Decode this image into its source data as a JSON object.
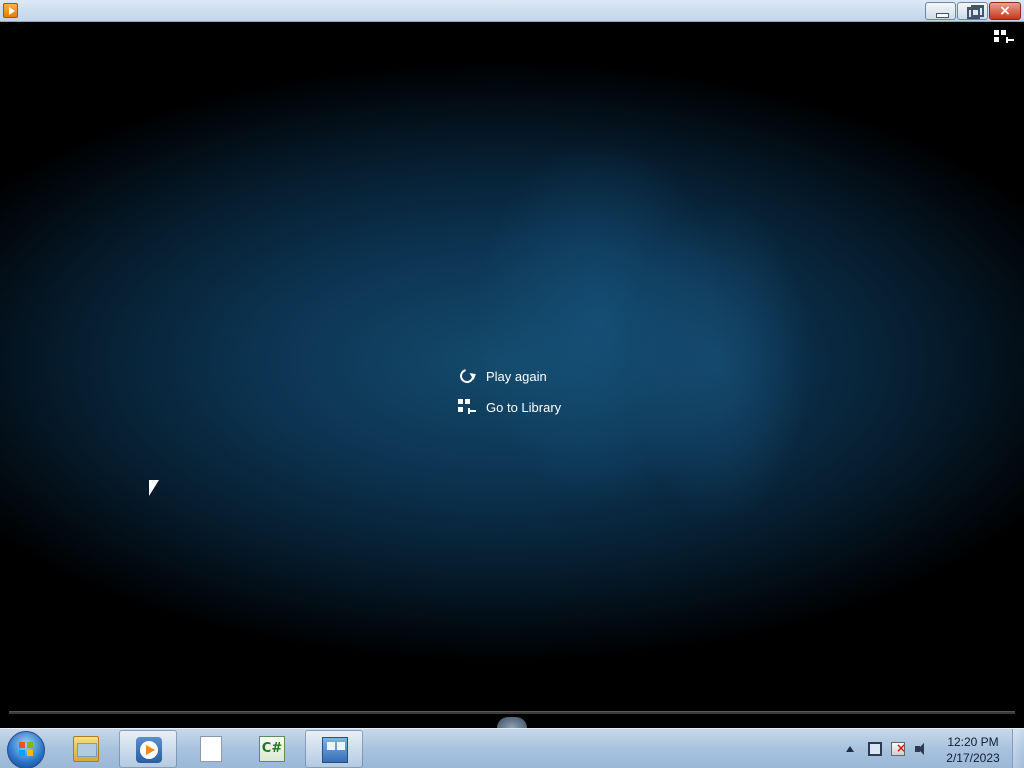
{
  "window": {
    "app_icon": "media-player-icon",
    "controls": [
      "minimize-icon",
      "restore-icon",
      "close-icon"
    ]
  },
  "player": {
    "top_right_icon": "switch-to-library-icon",
    "menu": {
      "play_again": "Play again",
      "go_to_library": "Go to Library"
    }
  },
  "taskbar": {
    "start_icon": "windows-start-icon",
    "pinned": [
      "file-explorer-icon",
      "windows-media-player-icon",
      "blank-document-icon",
      "csharp-project-icon",
      "remote-desktop-icon"
    ],
    "tray_icons": [
      "show-hidden-icons-icon",
      "network-icon",
      "action-center-icon",
      "volume-icon"
    ],
    "clock": {
      "time": "12:20 PM",
      "date": "2/17/2023"
    }
  }
}
